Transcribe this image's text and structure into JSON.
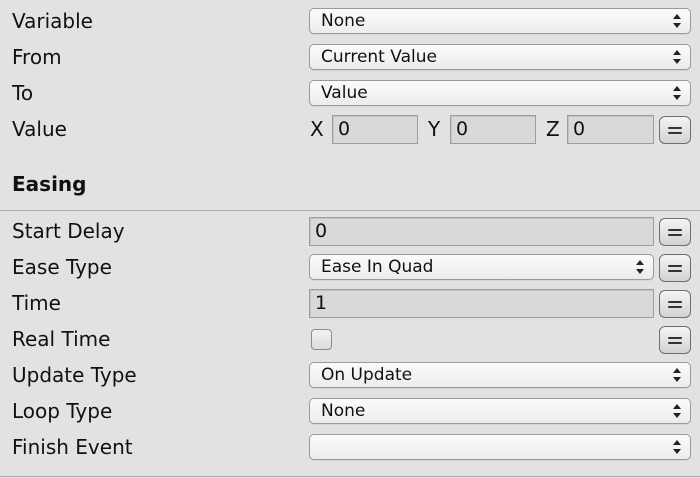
{
  "variable": {
    "label": "Variable",
    "value": "None"
  },
  "from": {
    "label": "From",
    "value": "Current Value"
  },
  "to": {
    "label": "To",
    "value": "Value"
  },
  "value": {
    "label": "Value",
    "x_label": "X",
    "x": "0",
    "y_label": "Y",
    "y": "0",
    "z_label": "Z",
    "z": "0"
  },
  "easing": {
    "title": "Easing",
    "start_delay": {
      "label": "Start Delay",
      "value": "0"
    },
    "ease_type": {
      "label": "Ease Type",
      "value": "Ease In Quad"
    },
    "time": {
      "label": "Time",
      "value": "1"
    },
    "real_time": {
      "label": "Real Time",
      "checked": false
    },
    "update_type": {
      "label": "Update Type",
      "value": "On Update"
    },
    "loop_type": {
      "label": "Loop Type",
      "value": "None"
    },
    "finish_event": {
      "label": "Finish Event",
      "value": ""
    }
  }
}
